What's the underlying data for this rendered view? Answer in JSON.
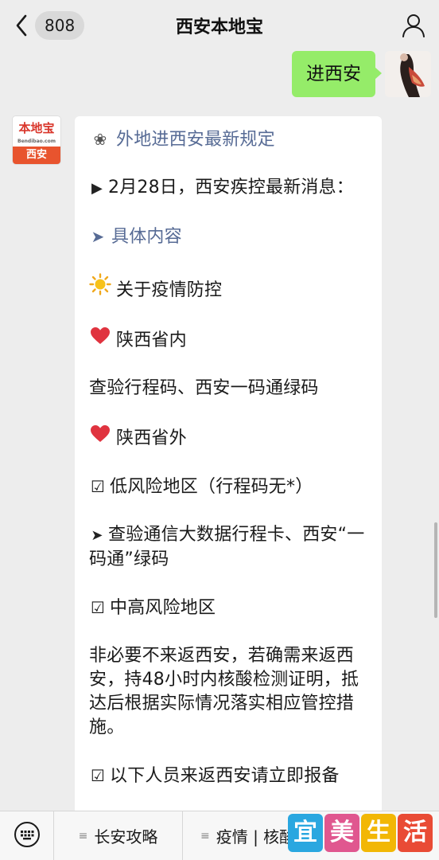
{
  "navbar": {
    "badge": "808",
    "title": "西安本地宝"
  },
  "outgoing": {
    "text": "进西安"
  },
  "account_logo": {
    "top": "本地宝",
    "sub": "Bendibao.com",
    "bottom": "西安"
  },
  "message": {
    "title": "外地进西安最新规定",
    "date_line": "2月28日，西安疾控最新消息：",
    "details_link": "具体内容",
    "section_title": "关于疫情防控",
    "inside_heading": "陕西省内",
    "inside_text": "查验行程码、西安一码通绿码",
    "outside_heading": "陕西省外",
    "low_risk": "低风险地区（行程码无*）",
    "low_risk_text": "查验通信大数据行程卡、西安“一码通”绿码",
    "mid_high_risk": "中高风险地区",
    "mid_high_text": "非必要不来返西安，若确需来返西安，持48小时内核酸检测证明，抵达后根据实际情况落实相应管控措施。",
    "report_line": "以下人员来返西安请立即报备"
  },
  "menu": {
    "items": [
      "长安攻略",
      "疫情 | 核酸"
    ]
  },
  "watermark": {
    "chars": [
      "宜",
      "美",
      "生",
      "活"
    ],
    "colors": [
      "#2aa7e0",
      "#e0578f",
      "#f2b705",
      "#e94b35"
    ]
  },
  "icons": [
    "chevron-left-icon",
    "profile-icon",
    "keyboard-icon",
    "flower-icon",
    "triangle-icon",
    "arrow-icon",
    "sun-icon",
    "heart-icon",
    "checkbox-icon",
    "menu-lines-icon"
  ]
}
